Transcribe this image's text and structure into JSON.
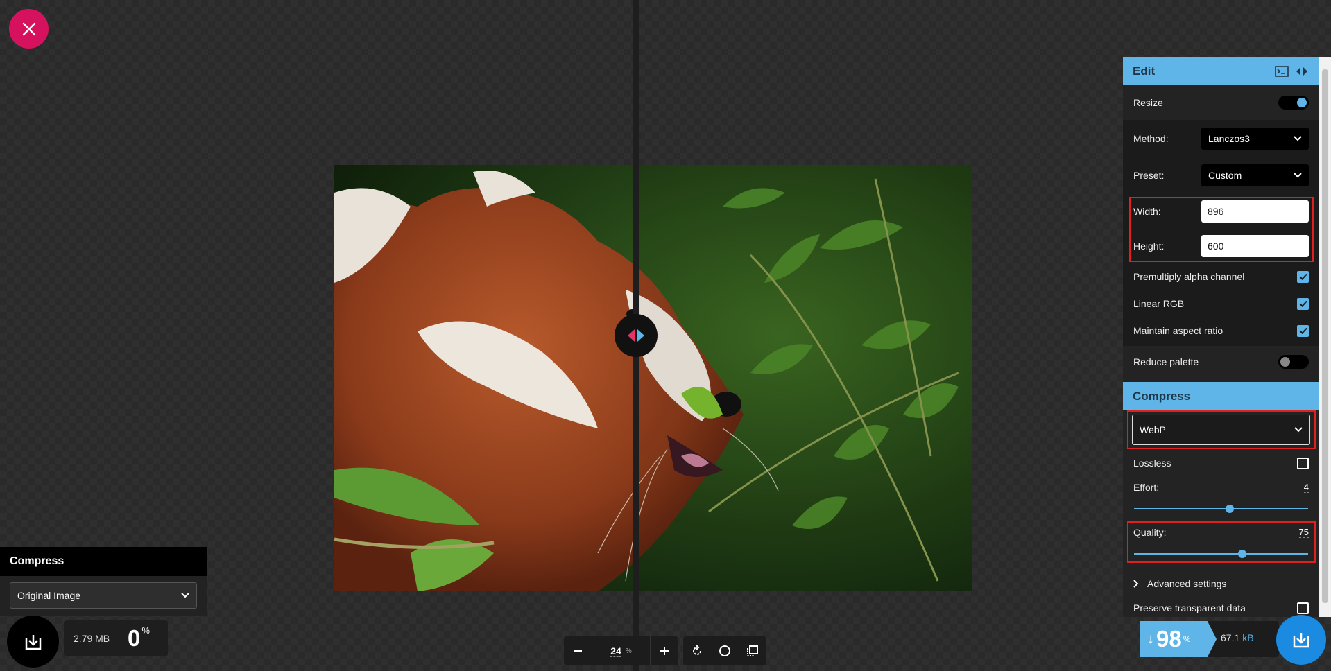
{
  "left_panel": {
    "title": "Compress",
    "selected_option": "Original Image",
    "file_size": "2.79 MB",
    "percent": "0",
    "percent_unit": "%"
  },
  "toolbar": {
    "zoom_out_icon": "minus-icon",
    "zoom_value": "24",
    "zoom_unit": "%",
    "zoom_in_icon": "plus-icon"
  },
  "edit": {
    "title": "Edit",
    "resize_label": "Resize",
    "resize_on": true,
    "method_label": "Method:",
    "method_value": "Lanczos3",
    "preset_label": "Preset:",
    "preset_value": "Custom",
    "width_label": "Width:",
    "width_value": "896",
    "height_label": "Height:",
    "height_value": "600",
    "premultiply_label": "Premultiply alpha channel",
    "linear_rgb_label": "Linear RGB",
    "aspect_label": "Maintain aspect ratio",
    "reduce_palette_label": "Reduce palette",
    "reduce_palette_on": false
  },
  "compress": {
    "title": "Compress",
    "format": "WebP",
    "lossless_label": "Lossless",
    "effort_label": "Effort:",
    "effort_value": "4",
    "effort_fraction": 0.55,
    "quality_label": "Quality:",
    "quality_value": "75",
    "quality_fraction": 0.62,
    "advanced_label": "Advanced settings",
    "preserve_label": "Preserve transparent data"
  },
  "result": {
    "percent": "98",
    "percent_unit": "%",
    "size": "67.1",
    "size_unit": "kB"
  },
  "colors": {
    "accent": "#5fb4e8",
    "close": "#d6125f",
    "highlight": "#e0201f"
  }
}
